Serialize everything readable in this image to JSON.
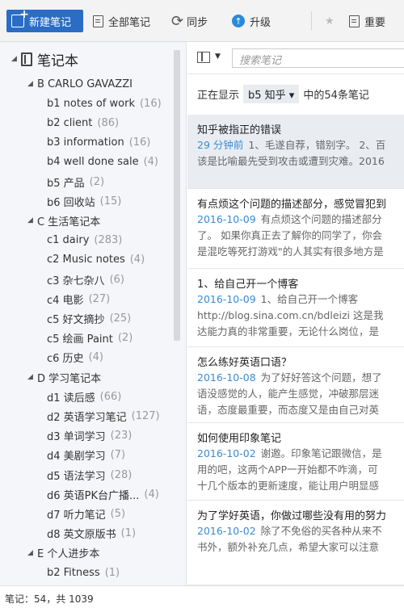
{
  "toolbar": {
    "new_note": "新建笔记",
    "all_notes": "全部笔记",
    "sync": "同步",
    "upgrade": "升级",
    "important": "重要"
  },
  "sidebar": {
    "root_label": "笔记本",
    "tree": [
      {
        "type": "stack",
        "label": "B CARLO GAVAZZI"
      },
      {
        "type": "notebook",
        "label": "b1 notes of work",
        "count": "(16)"
      },
      {
        "type": "notebook",
        "label": "b2 client",
        "count": "(86)"
      },
      {
        "type": "notebook",
        "label": "b3 information",
        "count": "(16)"
      },
      {
        "type": "notebook",
        "label": "b4 well done sale",
        "count": "(4)"
      },
      {
        "type": "notebook",
        "label": "b5 产品",
        "count": "(2)"
      },
      {
        "type": "notebook",
        "label": "b6 回收站",
        "count": "(15)"
      },
      {
        "type": "stack",
        "label": "C 生活笔记本"
      },
      {
        "type": "notebook",
        "label": "c1 dairy",
        "count": "(283)"
      },
      {
        "type": "notebook",
        "label": "c2 Music notes",
        "count": "(4)"
      },
      {
        "type": "notebook",
        "label": "c3 杂七杂八",
        "count": "(6)"
      },
      {
        "type": "notebook",
        "label": "c4 电影",
        "count": "(27)"
      },
      {
        "type": "notebook",
        "label": "c5 好文摘抄",
        "count": "(25)"
      },
      {
        "type": "notebook",
        "label": "c5 绘画 Paint",
        "count": "(2)"
      },
      {
        "type": "notebook",
        "label": "c6 历史",
        "count": "(4)"
      },
      {
        "type": "stack",
        "label": "D 学习笔记本"
      },
      {
        "type": "notebook",
        "label": "d1 读后感",
        "count": "(66)"
      },
      {
        "type": "notebook",
        "label": "d2 英语学习笔记",
        "count": "(127)"
      },
      {
        "type": "notebook",
        "label": "d3 单词学习",
        "count": "(23)"
      },
      {
        "type": "notebook",
        "label": "d4 美剧学习",
        "count": "(7)"
      },
      {
        "type": "notebook",
        "label": "d5 语法学习",
        "count": "(28)"
      },
      {
        "type": "notebook",
        "label": "d6 英语PK台广播...",
        "count": "(4)"
      },
      {
        "type": "notebook",
        "label": "d7 听力笔记",
        "count": "(5)"
      },
      {
        "type": "notebook",
        "label": "d8 英文原版书",
        "count": "(1)"
      },
      {
        "type": "stack",
        "label": "E 个人进步本"
      },
      {
        "type": "notebook",
        "label": "b2 Fitness",
        "count": "(1)"
      }
    ]
  },
  "main": {
    "search_placeholder": "搜索笔记",
    "filter_prefix": "正在显示",
    "filter_notebook": "b5 知乎",
    "filter_suffix": "中的54条笔记",
    "notes": [
      {
        "title": "知乎被指正的错误",
        "date": "29 分钟前",
        "line1": "1、毛遂自荐，错别字。 2、百",
        "line2": "该是比喻最先受到攻击或遭到灾难。2016"
      },
      {
        "title": "有点烦这个问题的描述部分，感觉冒犯到",
        "date": "2016-10-09",
        "line1": "有点烦这个问题的描述部分",
        "line2": "了。 如果你真正去了解你的同学了，你会",
        "line3": "是混吃等死打游戏\"的人其实有很多地方是"
      },
      {
        "title": "1、给自己开一个博客",
        "date": "2016-10-09",
        "line1": "1、给自己开一个博客",
        "line2": "http://blog.sina.com.cn/bdleizi 这是我",
        "line3": "达能力真的非常重要，无论什么岗位，是"
      },
      {
        "title": "怎么练好英语口语？",
        "date": "2016-10-08",
        "line1": "为了好好答这个问题，想了",
        "line2": "语没感觉的人，能产生感觉，冲破那层迷",
        "line3": "语，态度最重要，而态度又是由自己对英"
      },
      {
        "title": "如何使用印象笔记",
        "date": "2016-10-02",
        "line1": "谢邀。印象笔记跟微信，是",
        "line2": "用的吧，这两个APP一开始都不咋滴，可",
        "line3": "十几个版本的更新速度，能让用户明显感"
      },
      {
        "title": "为了学好英语，你做过哪些没有用的努力",
        "date": "2016-10-02",
        "line1": "除了不免俗的买各种从来不",
        "line2": "书外，额外补充几点，希望大家可以注意"
      }
    ]
  },
  "status": {
    "text": "笔记：54，共 1039"
  }
}
